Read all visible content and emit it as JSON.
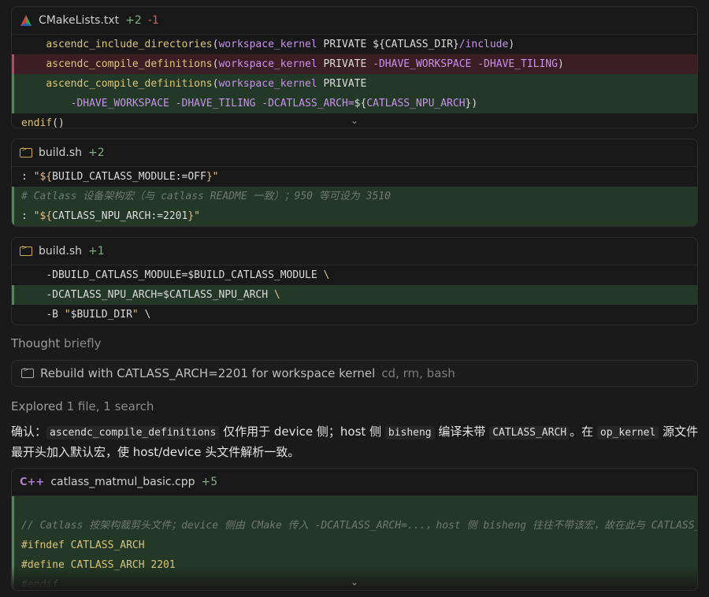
{
  "card1": {
    "filename": "CMakeLists.txt",
    "added": "+2",
    "removed": "-1",
    "lines": [
      {
        "kind": "ctx",
        "indent": "    ",
        "parts": [
          [
            "fn",
            "ascendc_include_directories"
          ],
          [
            "plain",
            "("
          ],
          [
            "var",
            "workspace_kernel"
          ],
          [
            "plain",
            " PRIVATE ${CATLASS_DIR}"
          ],
          [
            "var",
            "/include"
          ],
          [
            "plain",
            ")"
          ]
        ]
      },
      {
        "kind": "removed",
        "indent": "    ",
        "parts": [
          [
            "fn",
            "ascendc_compile_definitions"
          ],
          [
            "plain",
            "("
          ],
          [
            "var",
            "workspace_kernel"
          ],
          [
            "plain",
            " PRIVATE "
          ],
          [
            "var",
            "-DHAVE_WORKSPACE -DHAVE_TILING"
          ],
          [
            "plain",
            ")"
          ]
        ]
      },
      {
        "kind": "added",
        "indent": "    ",
        "parts": [
          [
            "fn",
            "ascendc_compile_definitions"
          ],
          [
            "plain",
            "("
          ],
          [
            "var",
            "workspace_kernel"
          ],
          [
            "plain",
            " PRIVATE"
          ]
        ]
      },
      {
        "kind": "added",
        "indent": "        ",
        "parts": [
          [
            "var",
            "-DHAVE_WORKSPACE -DHAVE_TILING -DCATLASS_ARCH="
          ],
          [
            "plain",
            "${"
          ],
          [
            "var",
            "CATLASS_NPU_ARCH"
          ],
          [
            "plain",
            "})"
          ]
        ]
      },
      {
        "kind": "ctx",
        "indent": "",
        "parts": [
          [
            "fn",
            "endif"
          ],
          [
            "plain",
            "()"
          ]
        ]
      }
    ]
  },
  "card2": {
    "filename": "build.sh",
    "added": "+2",
    "lines": [
      {
        "kind": "ctx",
        "indent": "",
        "parts": [
          [
            "plain",
            ": "
          ],
          [
            "str",
            "\"${"
          ],
          [
            "plain",
            "BUILD_CATLASS_MODULE:=OFF"
          ],
          [
            "str",
            "}\""
          ]
        ]
      },
      {
        "kind": "added",
        "indent": "",
        "parts": [
          [
            "cmt",
            "# Catlass 设备架构宏（与 catlass README 一致）；950 等可设为 3510"
          ]
        ]
      },
      {
        "kind": "added",
        "indent": "",
        "parts": [
          [
            "plain",
            ": "
          ],
          [
            "str",
            "\"${"
          ],
          [
            "plain",
            "CATLASS_NPU_ARCH:=2201"
          ],
          [
            "str",
            "}\""
          ]
        ]
      }
    ]
  },
  "card3": {
    "filename": "build.sh",
    "added": "+1",
    "lines": [
      {
        "kind": "ctx",
        "indent": "    ",
        "parts": [
          [
            "plain",
            "-DBUILD_CATLASS_MODULE=$BUILD_CATLASS_MODULE "
          ],
          [
            "str",
            "\\"
          ]
        ]
      },
      {
        "kind": "added",
        "indent": "    ",
        "parts": [
          [
            "plain",
            "-DCATLASS_NPU_ARCH=$CATLASS_NPU_ARCH "
          ],
          [
            "str",
            "\\"
          ]
        ]
      },
      {
        "kind": "ctx",
        "indent": "    ",
        "parts": [
          [
            "plain",
            "-B "
          ],
          [
            "str",
            "\""
          ],
          [
            "plain",
            "$BUILD_DIR"
          ],
          [
            "str",
            "\""
          ],
          [
            "plain",
            " \\"
          ]
        ]
      }
    ]
  },
  "thought": {
    "label": "Thought",
    "suffix": "briefly"
  },
  "command": {
    "text": "Rebuild with CATLASS_ARCH=2201 for workspace kernel",
    "tools": "cd, rm, bash"
  },
  "explored": {
    "label": "Explored",
    "suffix": "1 file, 1 search"
  },
  "paragraph": [
    [
      "t",
      "确认："
    ],
    [
      "c",
      "ascendc_compile_definitions"
    ],
    [
      "t",
      " 仅作用于 device 侧；host 侧 "
    ],
    [
      "c",
      "bisheng"
    ],
    [
      "t",
      " 编译未带 "
    ],
    [
      "c",
      "CATLASS_ARCH"
    ],
    [
      "t",
      "。在 "
    ],
    [
      "c",
      "op_kernel"
    ],
    [
      "t",
      " 源文件最开头加入默认宏，使 host/device 头文件解析一致。"
    ]
  ],
  "card4": {
    "filename": "catlass_matmul_basic.cpp",
    "added": "+5",
    "lines": [
      {
        "kind": "added",
        "indent": "",
        "parts": [
          [
            "plain",
            ""
          ]
        ]
      },
      {
        "kind": "added",
        "indent": "",
        "parts": [
          [
            "cmt",
            "// Catlass 按架构裁剪头文件；device 侧由 CMake 传入 -DCATLASS_ARCH=...，host 侧 bisheng 往往不带该宏，故在此与 CATLASS_NPU_ARCH 默认一致"
          ]
        ]
      },
      {
        "kind": "added",
        "indent": "",
        "parts": [
          [
            "kw",
            "#ifndef"
          ],
          [
            "plain",
            " "
          ],
          [
            "kw",
            "CATLASS_ARCH"
          ]
        ]
      },
      {
        "kind": "added",
        "indent": "",
        "parts": [
          [
            "kw",
            "#define"
          ],
          [
            "plain",
            " "
          ],
          [
            "kw",
            "CATLASS_ARCH"
          ],
          [
            "plain",
            " "
          ],
          [
            "num",
            "2201"
          ]
        ]
      },
      {
        "kind": "added",
        "indent": "",
        "parts": [
          [
            "cmt",
            "#endif"
          ]
        ]
      }
    ]
  }
}
